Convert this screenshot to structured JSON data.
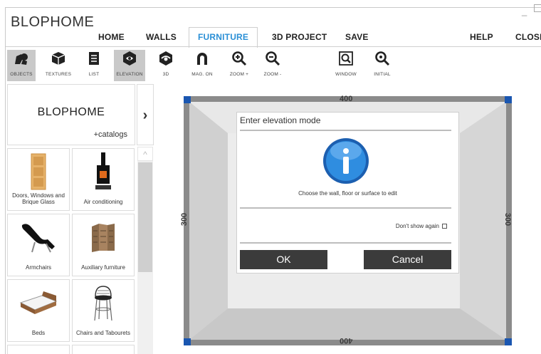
{
  "app": {
    "title": "BLOPHOME",
    "minimize_glyph": "_"
  },
  "menu": [
    {
      "label": "HOME"
    },
    {
      "label": "WALLS"
    },
    {
      "label": "FURNITURE",
      "active": true
    },
    {
      "label": "3D PROJECT"
    },
    {
      "label": "SAVE"
    },
    {
      "label": "HELP"
    },
    {
      "label": "CLOSE"
    }
  ],
  "toolbar": [
    {
      "label": "OBJECTS",
      "icon": "objects-icon",
      "selected": true
    },
    {
      "label": "TEXTURES",
      "icon": "cube-icon"
    },
    {
      "label": "LIST",
      "icon": "list-icon"
    },
    {
      "label": "ELEVATION",
      "icon": "elevation-icon",
      "selected": true
    },
    {
      "label": "3D",
      "icon": "3d-icon"
    },
    {
      "label": "MAG. ON",
      "icon": "magnet-icon"
    },
    {
      "label": "ZOOM +",
      "icon": "zoom-in-icon"
    },
    {
      "label": "ZOOM -",
      "icon": "zoom-out-icon"
    },
    {
      "label": "WINDOW",
      "icon": "zoom-window-icon"
    },
    {
      "label": "INITIAL",
      "icon": "zoom-initial-icon"
    }
  ],
  "sidebar": {
    "brand": "BLOPHOME",
    "catalogs_link": "+catalogs",
    "next_arrow": "›",
    "scroll_up": "^",
    "categories": [
      {
        "label": "Doors, Windows and Brique Glass",
        "icon": "door-icon"
      },
      {
        "label": "Air conditioning",
        "icon": "stove-icon"
      },
      {
        "label": "Armchairs",
        "icon": "lounge-chair-icon"
      },
      {
        "label": "Auxiliary furniture",
        "icon": "screen-divider-icon"
      },
      {
        "label": "Beds",
        "icon": "bed-icon"
      },
      {
        "label": "Chairs and Tabourets",
        "icon": "bar-stool-icon"
      }
    ]
  },
  "room": {
    "dim_top": "400",
    "dim_bottom": "400",
    "dim_left": "300",
    "dim_right": "300",
    "corner_color": "#1a56b0"
  },
  "dialog": {
    "title": "Enter elevation mode",
    "message": "Choose the wall, floor or surface to edit",
    "checkbox_label": "Don't show again",
    "ok_label": "OK",
    "cancel_label": "Cancel",
    "icon": "info-icon"
  },
  "colors": {
    "accent": "#2a8fd6",
    "button_bg": "#3b3b3b"
  }
}
